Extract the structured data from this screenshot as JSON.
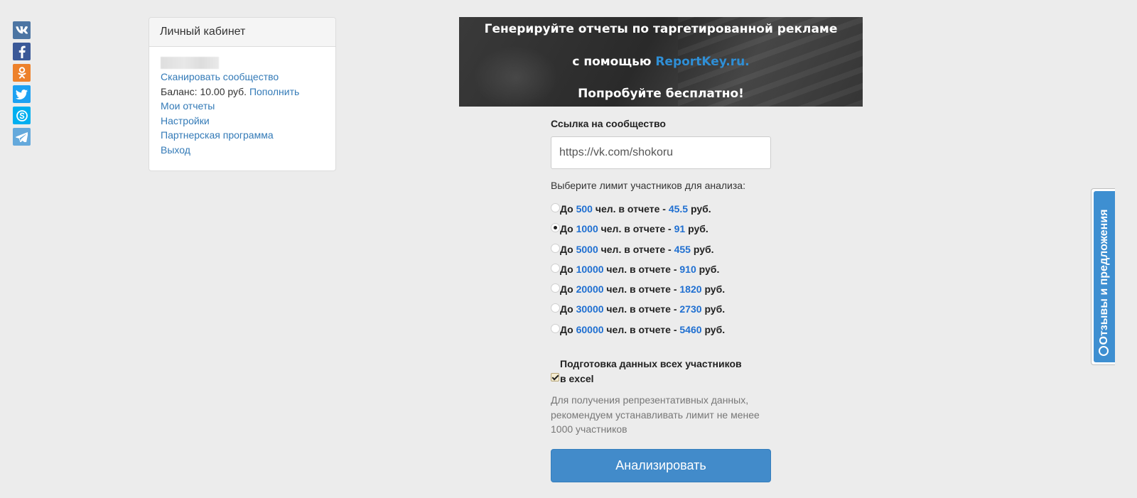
{
  "social": {
    "items": [
      {
        "name": "vk",
        "icon": "vk-icon",
        "color": "#4c75a3"
      },
      {
        "name": "facebook",
        "icon": "facebook-icon",
        "color": "#3b5998"
      },
      {
        "name": "odnoklassniki",
        "icon": "odnoklassniki-icon",
        "color": "#ed812b"
      },
      {
        "name": "twitter",
        "icon": "twitter-icon",
        "color": "#1da1f2"
      },
      {
        "name": "skype",
        "icon": "skype-icon",
        "color": "#00aff0"
      },
      {
        "name": "telegram",
        "icon": "telegram-icon",
        "color": "#64a9dc"
      }
    ]
  },
  "cabinet": {
    "title": "Личный кабинет",
    "scan_link": "Сканировать сообщество",
    "balance_label": "Баланс: 10.00 руб.",
    "topup_link": "Пополнить",
    "reports_link": "Мои отчеты",
    "settings_link": "Настройки",
    "partner_link": "Партнерская программа",
    "logout_link": "Выход"
  },
  "banner": {
    "line1": "Генерируйте отчеты по таргетированной рекламе",
    "line2_prefix": "с помощью",
    "line2_brand": "ReportKey.ru.",
    "line3": "Попробуйте бесплатно!"
  },
  "form": {
    "community_label": "Ссылка на сообщество",
    "community_value": "https://vk.com/shokoru",
    "limit_title": "Выберите лимит участников для анализа:",
    "option_prefix": "До",
    "option_middle": "чел. в отчете -",
    "option_suffix": "руб.",
    "options": [
      {
        "limit": "500",
        "price": "45.5",
        "checked": false
      },
      {
        "limit": "1000",
        "price": "91",
        "checked": true
      },
      {
        "limit": "5000",
        "price": "455",
        "checked": false
      },
      {
        "limit": "10000",
        "price": "910",
        "checked": false
      },
      {
        "limit": "20000",
        "price": "1820",
        "checked": false
      },
      {
        "limit": "30000",
        "price": "2730",
        "checked": false
      },
      {
        "limit": "60000",
        "price": "5460",
        "checked": false
      }
    ],
    "excel_line1": "Подготовка данных всех участников",
    "excel_line2": "в excel",
    "excel_checked": true,
    "hint": "Для получения репрезентативных данных, рекомендуем устанавливать лимит не менее 1000 участников",
    "analyze_button": "Анализировать"
  },
  "feedback": {
    "label": "Отзывы и предложения",
    "icon": "chat-icon"
  },
  "colors": {
    "link": "#337ab7",
    "accent_number": "#1f6fd1",
    "button": "#428bca",
    "feedback": "#3e8fd1",
    "background": "#ececec"
  }
}
